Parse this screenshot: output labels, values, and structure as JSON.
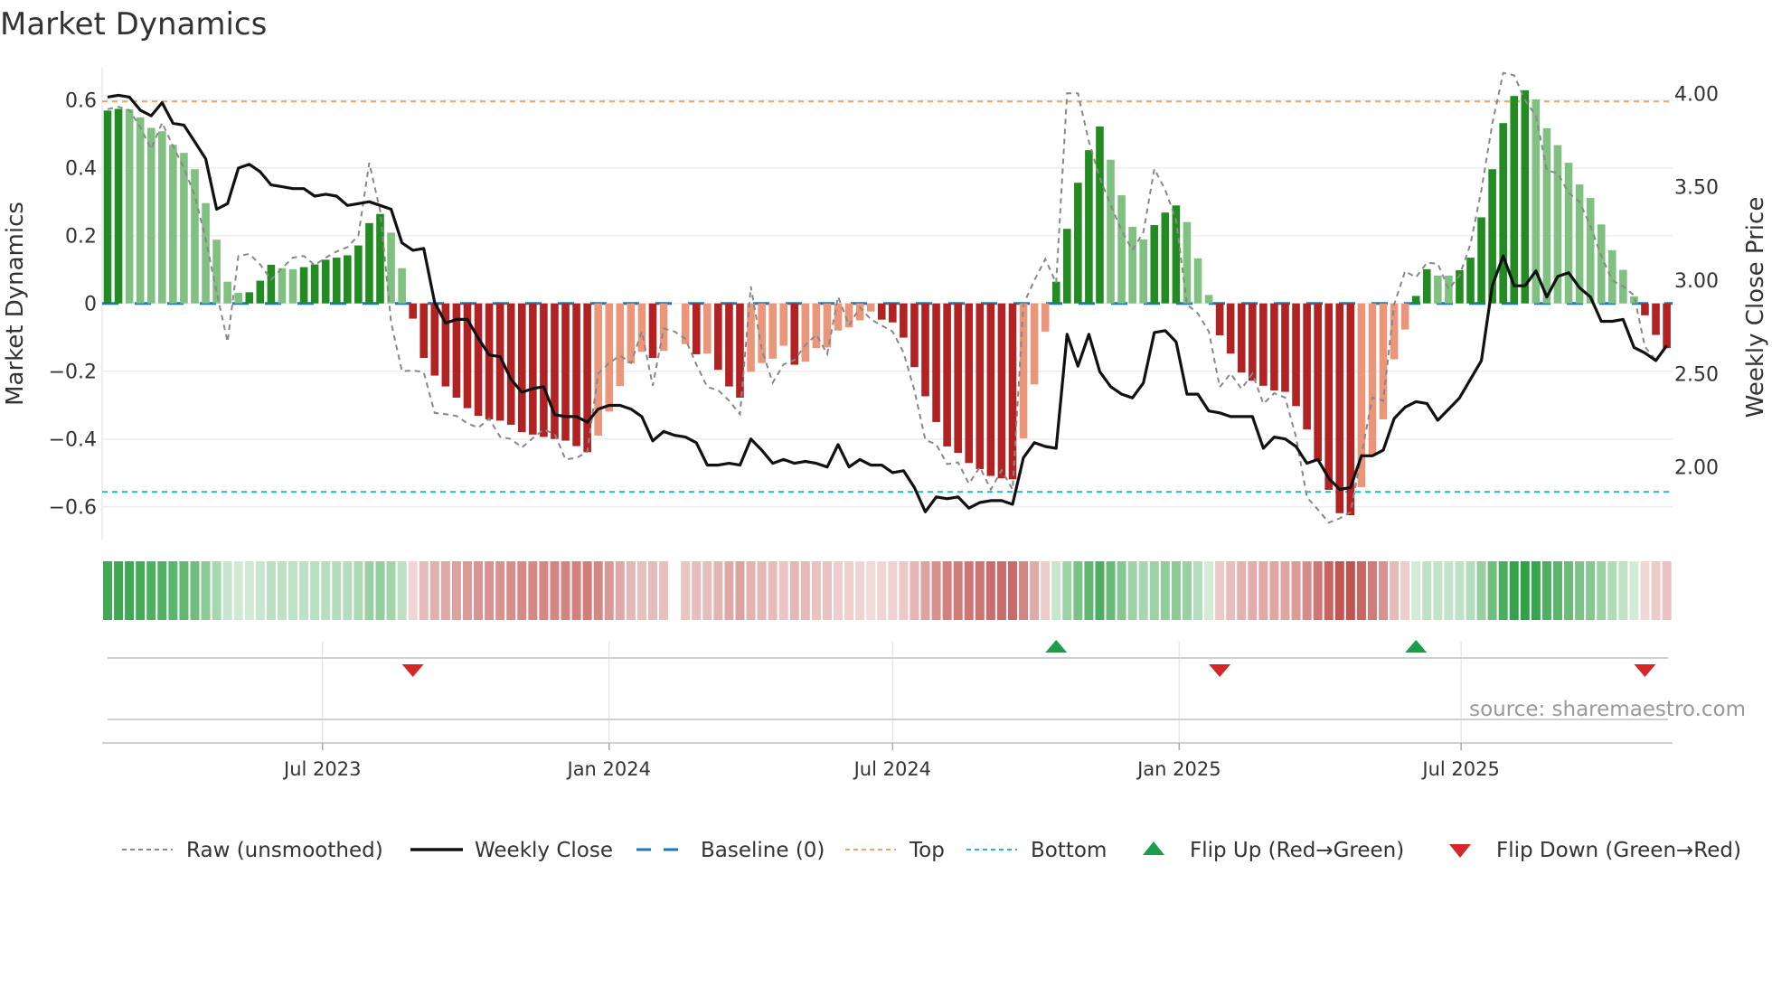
{
  "title": "Market Dynamics",
  "source": "source: sharemaestro.com",
  "colors": {
    "bar_pos_strong": "#228b22",
    "bar_pos_weak": "#80c080",
    "bar_neg_strong": "#b22222",
    "bar_neg_weak": "#e9967a",
    "strip_pos": "#2ea043",
    "strip_neg": "#c0504d",
    "raw": "#888888",
    "close": "#111111",
    "baseline": "#1f77b4",
    "top": "#f4a460",
    "bottom": "#17becf",
    "flip_up": "#1a9e4a",
    "flip_down": "#d62728"
  },
  "chart_data": {
    "type": "bar",
    "title": "Market Dynamics",
    "ylabel": "Market Dynamics",
    "y2label": "Weekly Close Price",
    "ylim": [
      -0.66,
      0.7
    ],
    "y2lim": [
      1.72,
      4.15
    ],
    "x_start": "2023-02-13",
    "x_step_days": 7,
    "yticks": [
      {
        "v": 0.6,
        "label": "0.6"
      },
      {
        "v": 0.4,
        "label": "0.4"
      },
      {
        "v": 0.2,
        "label": "0.2"
      },
      {
        "v": 0,
        "label": "0"
      },
      {
        "v": -0.2,
        "label": "−0.2"
      },
      {
        "v": -0.4,
        "label": "−0.4"
      },
      {
        "v": -0.6,
        "label": "−0.6"
      }
    ],
    "y2ticks": [
      {
        "v": 4.0,
        "label": "4.00"
      },
      {
        "v": 3.5,
        "label": "3.50"
      },
      {
        "v": 3.0,
        "label": "3.00"
      },
      {
        "v": 2.5,
        "label": "2.50"
      },
      {
        "v": 2.0,
        "label": "2.00"
      }
    ],
    "xticks": [
      {
        "date": "2023-07-01",
        "label": "Jul 2023"
      },
      {
        "date": "2024-01-01",
        "label": "Jan 2024"
      },
      {
        "date": "2024-07-01",
        "label": "Jul 2024"
      },
      {
        "date": "2025-01-01",
        "label": "Jan 2025"
      },
      {
        "date": "2025-07-01",
        "label": "Jul 2025"
      }
    ],
    "baseline": 0,
    "top": 0.596,
    "bottom": -0.556,
    "values": [
      0.569,
      0.574,
      0.573,
      0.549,
      0.518,
      0.508,
      0.468,
      0.444,
      0.396,
      0.296,
      0.188,
      0.064,
      0.031,
      0.033,
      0.067,
      0.114,
      0.104,
      0.101,
      0.107,
      0.115,
      0.129,
      0.135,
      0.142,
      0.171,
      0.237,
      0.264,
      0.209,
      0.104,
      -0.045,
      -0.161,
      -0.213,
      -0.245,
      -0.278,
      -0.309,
      -0.332,
      -0.342,
      -0.346,
      -0.358,
      -0.38,
      -0.387,
      -0.394,
      -0.4,
      -0.405,
      -0.421,
      -0.439,
      -0.39,
      -0.319,
      -0.244,
      -0.177,
      -0.143,
      -0.161,
      -0.14,
      null,
      -0.12,
      -0.15,
      -0.148,
      -0.196,
      -0.245,
      -0.278,
      -0.202,
      -0.176,
      -0.163,
      -0.125,
      -0.181,
      -0.172,
      -0.132,
      -0.13,
      -0.08,
      -0.071,
      -0.05,
      -0.024,
      -0.048,
      -0.056,
      -0.101,
      -0.188,
      -0.274,
      -0.35,
      -0.422,
      -0.441,
      -0.471,
      -0.489,
      -0.509,
      -0.516,
      -0.519,
      -0.398,
      -0.239,
      -0.083,
      0.064,
      0.22,
      0.356,
      0.452,
      0.522,
      0.424,
      0.319,
      0.226,
      0.189,
      0.231,
      0.268,
      0.289,
      0.24,
      0.133,
      0.025,
      -0.094,
      -0.148,
      -0.204,
      -0.228,
      -0.243,
      -0.257,
      -0.261,
      -0.303,
      -0.372,
      -0.465,
      -0.55,
      -0.619,
      -0.625,
      -0.542,
      -0.449,
      -0.342,
      -0.165,
      -0.077,
      0.022,
      0.101,
      0.082,
      0.082,
      0.098,
      0.135,
      0.254,
      0.396,
      0.532,
      0.612,
      0.629,
      0.602,
      0.517,
      0.467,
      0.415,
      0.351,
      0.311,
      0.233,
      0.157,
      0.099,
      0.021,
      -0.035,
      -0.093,
      -0.132
    ],
    "raw": [
      0.573,
      0.58,
      0.57,
      0.52,
      0.455,
      0.533,
      0.464,
      0.4,
      0.317,
      0.19,
      0.033,
      -0.114,
      0.14,
      0.146,
      0.115,
      0.07,
      0.104,
      0.135,
      0.14,
      0.113,
      0.135,
      0.153,
      0.166,
      0.2,
      0.415,
      0.273,
      -0.056,
      -0.2,
      -0.198,
      -0.203,
      -0.323,
      -0.327,
      -0.332,
      -0.354,
      -0.367,
      -0.34,
      -0.394,
      -0.4,
      -0.425,
      -0.398,
      -0.372,
      -0.385,
      -0.46,
      -0.456,
      -0.438,
      -0.207,
      -0.176,
      -0.154,
      -0.176,
      -0.083,
      -0.243,
      -0.074,
      -0.083,
      -0.105,
      -0.18,
      -0.247,
      -0.256,
      -0.287,
      -0.327,
      0.05,
      -0.136,
      -0.234,
      -0.18,
      -0.167,
      -0.123,
      -0.092,
      -0.149,
      0.02,
      -0.065,
      -0.012,
      -0.047,
      -0.065,
      -0.083,
      -0.145,
      -0.256,
      -0.403,
      -0.416,
      -0.474,
      -0.469,
      -0.532,
      -0.483,
      -0.549,
      -0.492,
      -0.549,
      -0.003,
      0.068,
      0.131,
      0.06,
      0.62,
      0.62,
      0.477,
      0.37,
      0.29,
      0.215,
      0.157,
      0.21,
      0.397,
      0.335,
      0.246,
      -0.003,
      -0.03,
      -0.083,
      -0.247,
      -0.207,
      -0.252,
      -0.207,
      -0.296,
      -0.265,
      -0.278,
      -0.394,
      -0.572,
      -0.608,
      -0.647,
      -0.634,
      -0.616,
      -0.447,
      -0.278,
      -0.287,
      -0.003,
      0.095,
      0.077,
      0.12,
      0.117,
      0.042,
      0.082,
      0.175,
      0.335,
      0.53,
      0.68,
      0.673,
      0.6,
      0.553,
      0.393,
      0.384,
      0.326,
      0.3,
      0.228,
      0.14,
      0.068,
      0.05,
      0.024,
      -0.128,
      -0.167,
      -0.127
    ],
    "close": [
      3.98,
      3.99,
      3.98,
      3.91,
      3.88,
      3.95,
      3.84,
      3.83,
      3.74,
      3.65,
      3.38,
      3.41,
      3.6,
      3.62,
      3.58,
      3.51,
      3.5,
      3.49,
      3.49,
      3.45,
      3.46,
      3.45,
      3.4,
      3.41,
      3.42,
      3.4,
      3.38,
      3.2,
      3.16,
      3.17,
      2.88,
      2.77,
      2.79,
      2.79,
      2.69,
      2.6,
      2.59,
      2.47,
      2.4,
      2.42,
      2.43,
      2.28,
      2.27,
      2.27,
      2.24,
      2.31,
      2.33,
      2.33,
      2.31,
      2.27,
      2.14,
      2.19,
      2.17,
      2.16,
      2.13,
      2.01,
      2.01,
      2.02,
      2.01,
      2.15,
      2.09,
      2.02,
      2.04,
      2.02,
      2.03,
      2.02,
      2.0,
      2.12,
      2.0,
      2.04,
      2.01,
      2.01,
      1.97,
      1.98,
      1.89,
      1.76,
      1.84,
      1.83,
      1.84,
      1.78,
      1.81,
      1.82,
      1.82,
      1.8,
      2.05,
      2.13,
      2.11,
      2.1,
      2.71,
      2.54,
      2.71,
      2.51,
      2.43,
      2.39,
      2.37,
      2.45,
      2.72,
      2.73,
      2.67,
      2.39,
      2.39,
      2.3,
      2.29,
      2.27,
      2.27,
      2.27,
      2.1,
      2.16,
      2.15,
      2.11,
      2.02,
      2.04,
      1.94,
      1.88,
      1.89,
      2.06,
      2.06,
      2.09,
      2.26,
      2.32,
      2.35,
      2.34,
      2.25,
      2.31,
      2.37,
      2.47,
      2.57,
      2.97,
      3.13,
      2.97,
      2.97,
      3.05,
      2.91,
      3.02,
      3.04,
      2.96,
      2.91,
      2.78,
      2.78,
      2.79,
      2.64,
      2.61,
      2.57,
      2.65
    ],
    "flips": [
      {
        "week": 28,
        "dir": "down"
      },
      {
        "week": 87,
        "dir": "up"
      },
      {
        "week": 102,
        "dir": "down"
      },
      {
        "week": 120,
        "dir": "up"
      },
      {
        "week": 141,
        "dir": "down"
      }
    ],
    "legend": {
      "placement": "bottom",
      "items": [
        {
          "key": "raw",
          "label": "Raw (unsmoothed)"
        },
        {
          "key": "close",
          "label": "Weekly Close"
        },
        {
          "key": "baseline",
          "label": "Baseline (0)"
        },
        {
          "key": "top",
          "label": "Top"
        },
        {
          "key": "bottom",
          "label": "Bottom"
        },
        {
          "key": "flip_up",
          "label": "Flip Up (Red→Green)"
        },
        {
          "key": "flip_down",
          "label": "Flip Down (Green→Red)"
        }
      ]
    }
  }
}
